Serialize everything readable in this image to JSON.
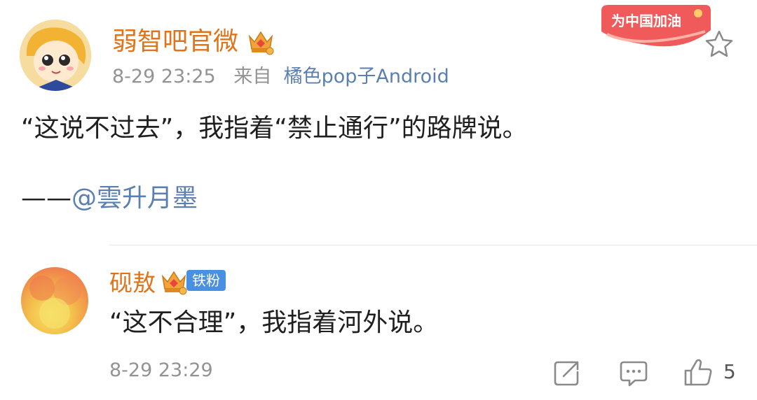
{
  "post": {
    "author": "弱智吧官微",
    "time": "8-29 23:25",
    "source_prefix": "来自",
    "source": "橘色pop子Android",
    "text": "“这说不过去”，我指着“禁止通行”的路牌说。",
    "signature_dash": "——",
    "signature_mention": "@雲升月墨",
    "promo_text": "为中国加油"
  },
  "comment": {
    "author": "砚敖",
    "fan_badge": "铁粉",
    "text": "“这不合理”，我指着河外说。",
    "time": "8-29 23:29",
    "like_count": "5"
  },
  "icons": {
    "crown": "crown-vip-icon",
    "star": "star-outline-icon",
    "share": "share-icon",
    "comment": "comment-icon",
    "like": "thumbs-up-icon"
  },
  "colors": {
    "username": "#e0741a",
    "link": "#5a7fb0",
    "meta": "#939393",
    "badge": "#4a90e2",
    "promo": "#f05a5a"
  }
}
